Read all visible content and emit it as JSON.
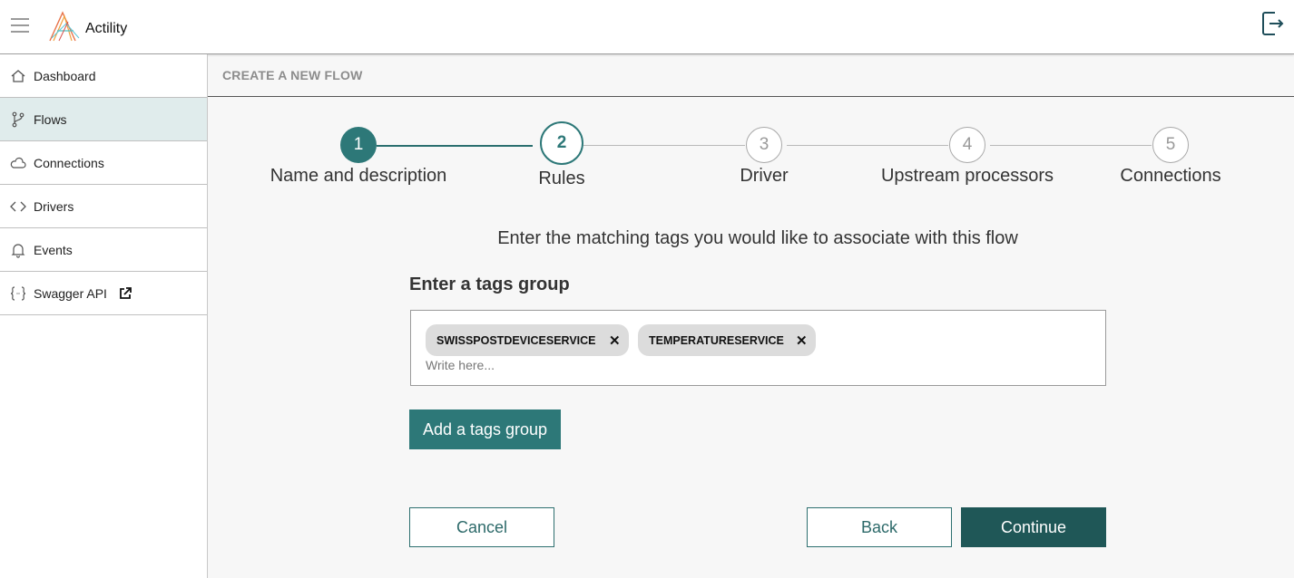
{
  "app": {
    "brand": "Actility"
  },
  "sidebar": {
    "items": [
      {
        "label": "Dashboard",
        "icon": "home-icon",
        "active": false
      },
      {
        "label": "Flows",
        "icon": "branch-icon",
        "active": true
      },
      {
        "label": "Connections",
        "icon": "cloud-icon",
        "active": false
      },
      {
        "label": "Drivers",
        "icon": "code-icon",
        "active": false
      },
      {
        "label": "Events",
        "icon": "bell-icon",
        "active": false
      },
      {
        "label": "Swagger API",
        "icon": "braces-icon",
        "active": false,
        "external": "external-link-icon"
      }
    ]
  },
  "page": {
    "title": "CREATE A NEW FLOW"
  },
  "stepper": {
    "current": 2,
    "steps": [
      {
        "number": "1",
        "label": "Name and description",
        "state": "done"
      },
      {
        "number": "2",
        "label": "Rules",
        "state": "current"
      },
      {
        "number": "3",
        "label": "Driver",
        "state": "todo"
      },
      {
        "number": "4",
        "label": "Upstream processors",
        "state": "todo"
      },
      {
        "number": "5",
        "label": "Connections",
        "state": "todo"
      }
    ]
  },
  "rules": {
    "instruction": "Enter the matching tags you would like to associate with this flow",
    "group_title": "Enter a tags group",
    "tags": [
      "SWISSPOSTDEVICESERVICE",
      "TEMPERATURESERVICE"
    ],
    "input_placeholder": "Write here...",
    "input_value": "",
    "add_group_label": "Add a tags group"
  },
  "actions": {
    "cancel_label": "Cancel",
    "back_label": "Back",
    "continue_label": "Continue"
  },
  "colors": {
    "accent": "#2d7878",
    "accent_dark": "#1f5757",
    "active_nav_bg": "#e0ecec"
  }
}
